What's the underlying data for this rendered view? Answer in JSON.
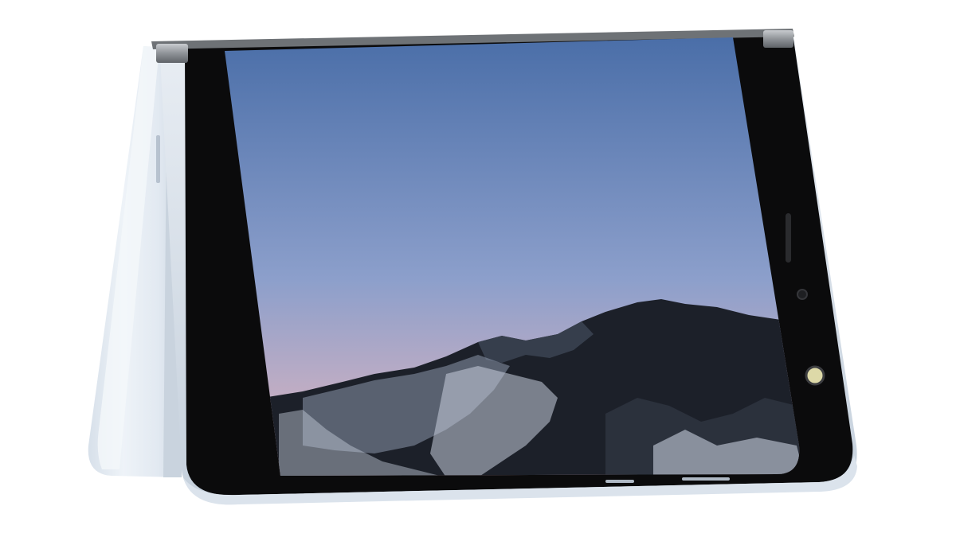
{
  "scene": {
    "subject": "dual-screen-folding-phone",
    "pose": "tent-mode",
    "wallpaper": "mountain-ridge-at-dusk"
  },
  "colors": {
    "background": "#ffffff",
    "body_shell": "#e2e9f1",
    "body_shade": "#c3cedb",
    "bezel": "#0b0b0c",
    "hinge_metal": "#9a9ea3",
    "sky_top": "#4a6ea8",
    "sky_mid": "#8c9fcb",
    "sky_horizon": "#e5b7bf",
    "mountain_dark": "#1c2029",
    "snow": "#c8d0de"
  }
}
